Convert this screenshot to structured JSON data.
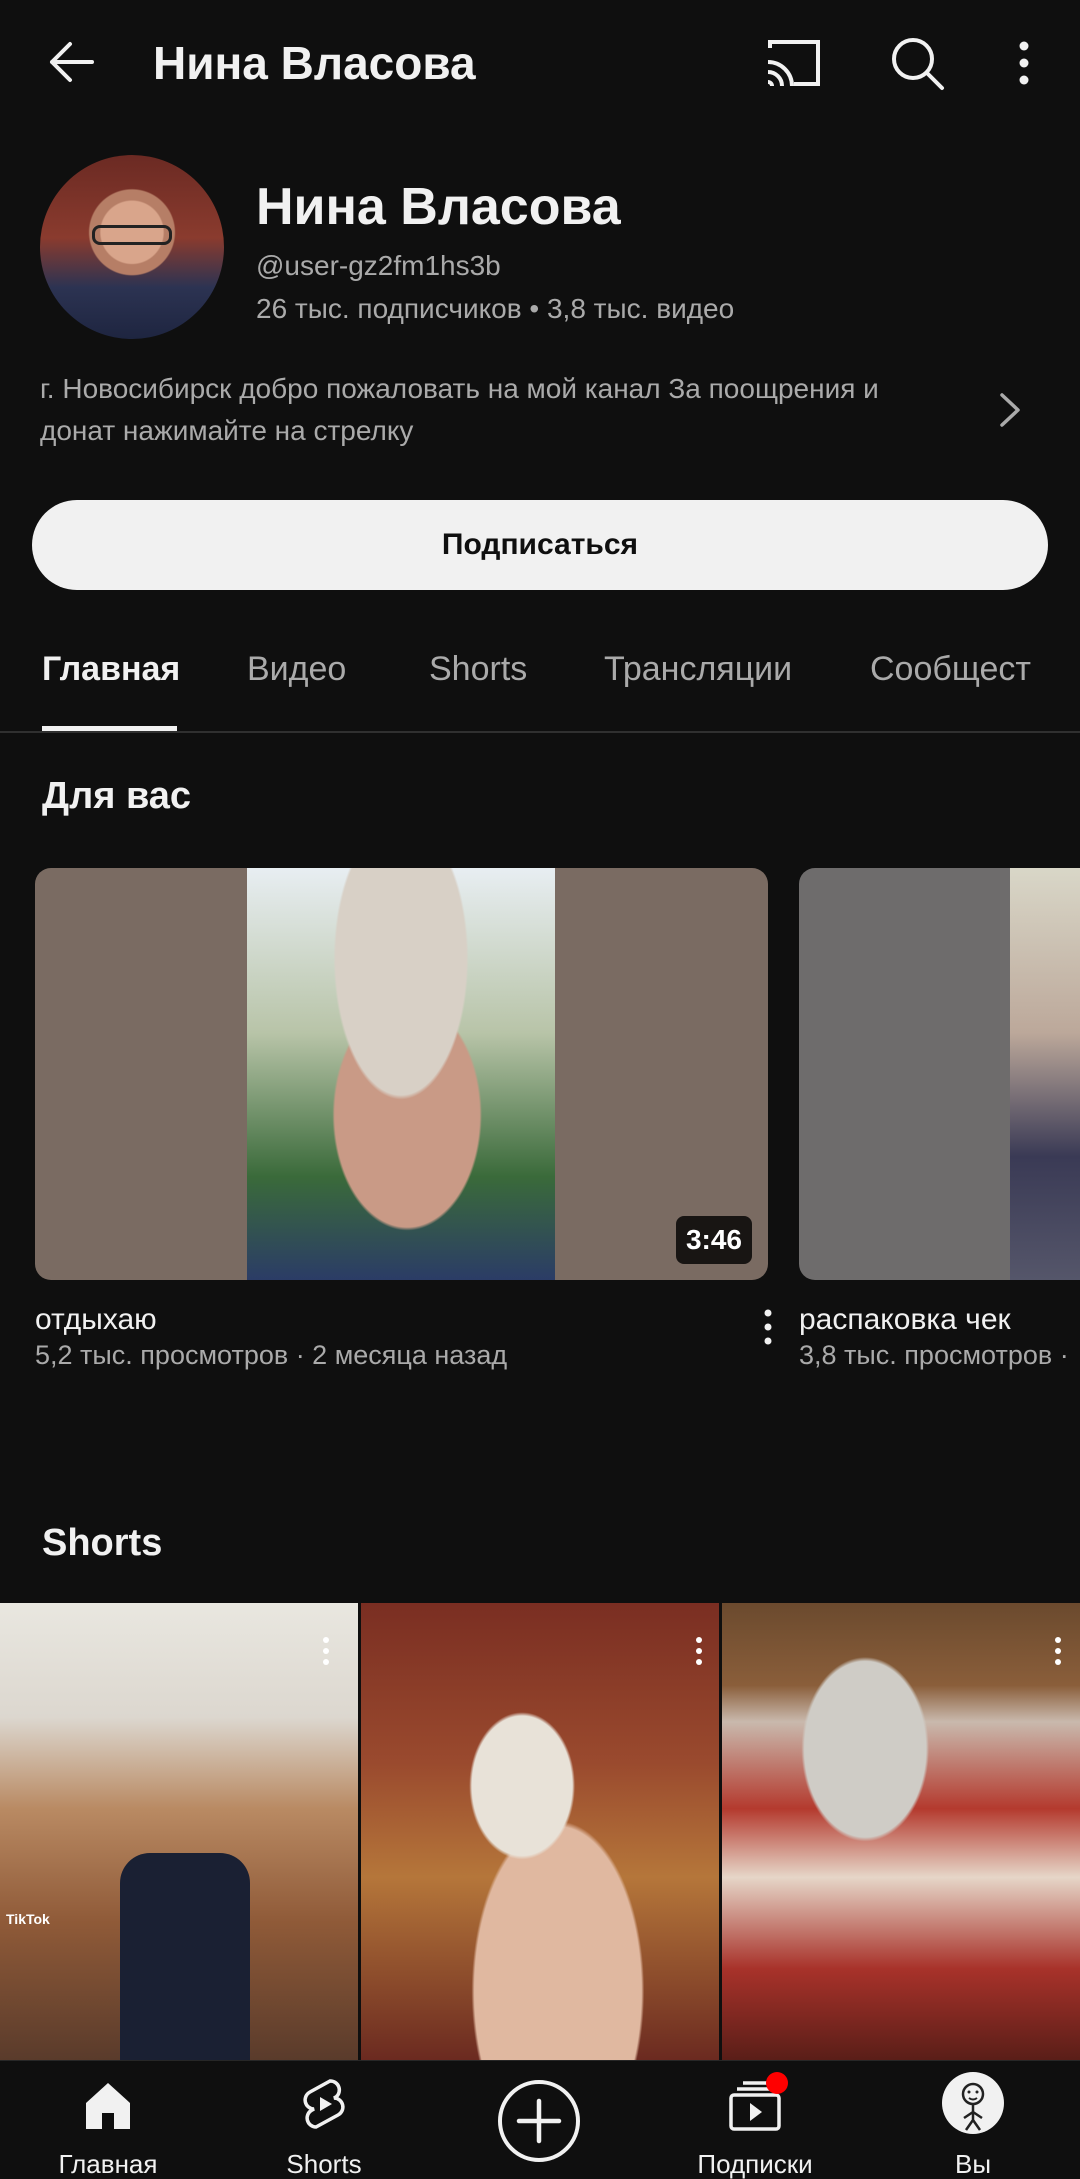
{
  "header": {
    "title": "Нина Власова"
  },
  "channel": {
    "name": "Нина Власова",
    "handle": "@user-gz2fm1hs3b",
    "stats": "26 тыс. подписчиков • 3,8 тыс. видео",
    "description": "г. Новосибирск добро пожаловать на мой канал За поощрения и донат нажимайте на стрелку",
    "subscribe_label": "Подписаться"
  },
  "tabs": [
    {
      "label": "Главная",
      "active": true
    },
    {
      "label": "Видео",
      "active": false
    },
    {
      "label": "Shorts",
      "active": false
    },
    {
      "label": "Трансляции",
      "active": false
    },
    {
      "label": "Сообщест",
      "active": false
    }
  ],
  "for_you": {
    "title": "Для вас",
    "videos": [
      {
        "title": "отдыхаю",
        "meta": "5,2 тыс. просмотров · 2 месяца назад",
        "duration": "3:46"
      },
      {
        "title": "распаковка чек",
        "meta": "3,8 тыс. просмотров ·"
      }
    ]
  },
  "shorts": {
    "title": "Shorts",
    "items": [
      {
        "watermark": "TikTok"
      },
      {},
      {}
    ]
  },
  "bottom_nav": [
    {
      "label": "Главная",
      "icon": "home-icon"
    },
    {
      "label": "Shorts",
      "icon": "shorts-icon"
    },
    {
      "label": "",
      "icon": "create-icon"
    },
    {
      "label": "Подписки",
      "icon": "subscriptions-icon"
    },
    {
      "label": "Вы",
      "icon": "you-avatar"
    }
  ],
  "colors": {
    "background": "#0f0f0f",
    "text_primary": "#f1f1f1",
    "text_secondary": "#aaaaaa",
    "notification": "#ff0000"
  }
}
